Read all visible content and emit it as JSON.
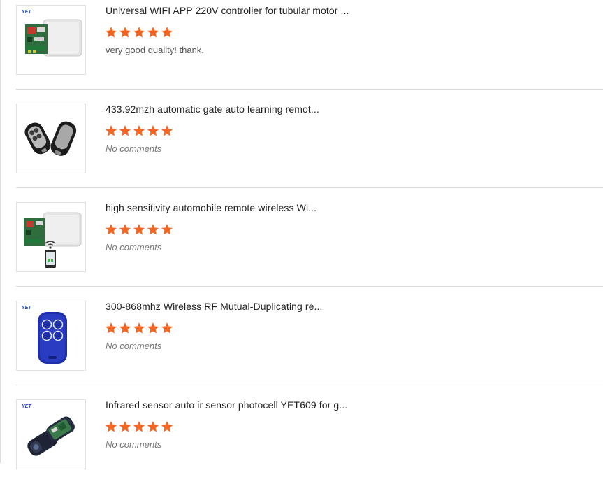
{
  "colors": {
    "star": "#f26522",
    "title": "#222222",
    "divider": "#d9d9d9"
  },
  "reviews": [
    {
      "title": "Universal WIFI APP 220V controller for tubular motor ...",
      "rating": 5,
      "comment": "very good quality! thank.",
      "image_icon": "wifi-controller-board-icon",
      "brand_mark": "YET"
    },
    {
      "title": "433.92mzh automatic gate auto learning remot...",
      "rating": 5,
      "comment": "No comments",
      "image_icon": "key-fob-remotes-icon"
    },
    {
      "title": "high sensitivity automobile remote wireless Wi...",
      "rating": 5,
      "comment": "No comments",
      "image_icon": "receiver-and-phone-icon"
    },
    {
      "title": "300-868mhz Wireless RF Mutual-Duplicating re...",
      "rating": 5,
      "comment": "No comments",
      "image_icon": "blue-remote-icon",
      "brand_mark": "YET"
    },
    {
      "title": "Infrared sensor auto ir sensor photocell YET609 for g...",
      "rating": 5,
      "comment": "No comments",
      "image_icon": "photocell-sensor-icon",
      "brand_mark": "YET"
    }
  ]
}
